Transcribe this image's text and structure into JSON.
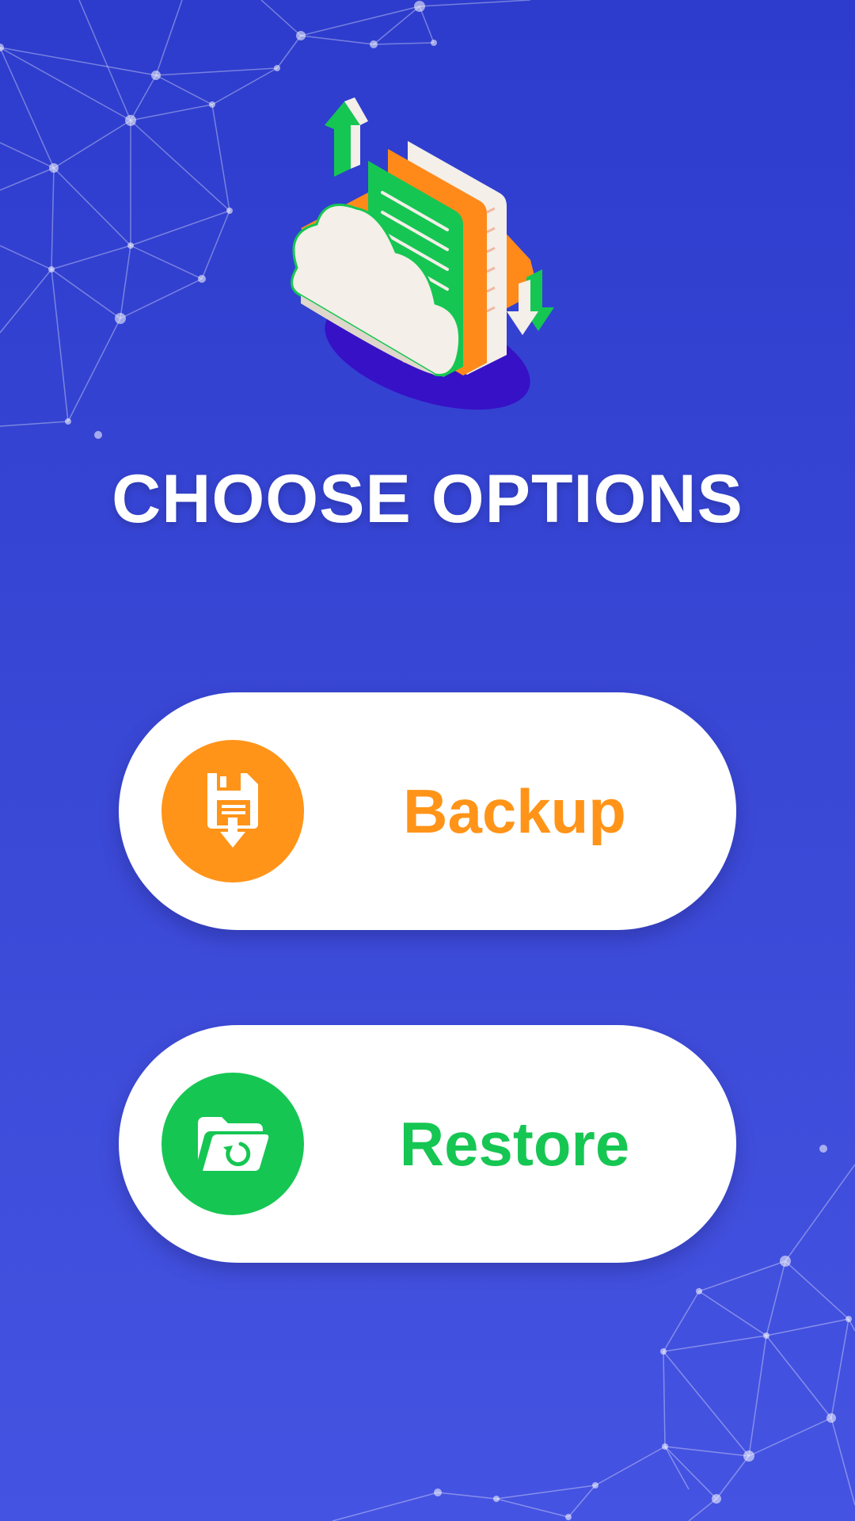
{
  "title": "CHOOSE OPTIONS",
  "colors": {
    "background_top": "#2d3ccd",
    "background_bottom": "#4553e2",
    "backup_accent": "#ff9419",
    "restore_accent": "#16c653",
    "button_background": "#ffffff"
  },
  "hero": {
    "icon": "cloud-documents-sync-illustration"
  },
  "options": [
    {
      "id": "backup",
      "label": "Backup",
      "icon": "floppy-disk-download-icon",
      "color": "#ff9419"
    },
    {
      "id": "restore",
      "label": "Restore",
      "icon": "folder-restore-icon",
      "color": "#16c653"
    }
  ]
}
